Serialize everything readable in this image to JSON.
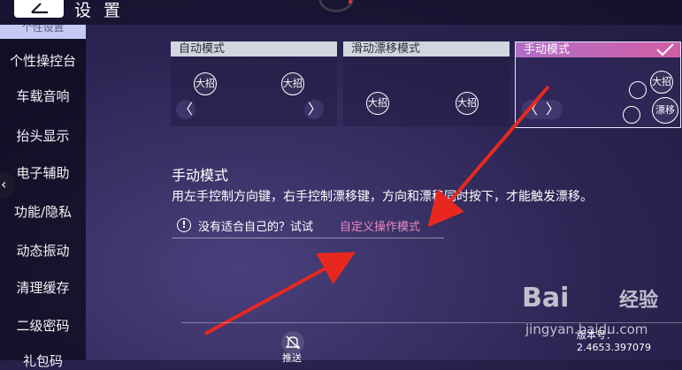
{
  "header": {
    "title": "设 置",
    "active_tab_partial": "个性设置"
  },
  "sidebar": {
    "items": [
      {
        "label": "个性操控台"
      },
      {
        "label": "车载音响"
      },
      {
        "label": "抬头显示"
      },
      {
        "label": "电子辅助"
      },
      {
        "label": "功能/隐私"
      },
      {
        "label": "动态振动"
      },
      {
        "label": "清理缓存"
      },
      {
        "label": "二级密码"
      },
      {
        "label": "礼包码"
      }
    ],
    "collapse_icon": "chevron-left-icon"
  },
  "modes": [
    {
      "title": "自动模式",
      "buttons": [
        "大招",
        "大招"
      ],
      "arrows": [
        "〈",
        "〉"
      ]
    },
    {
      "title": "滑动漂移模式",
      "buttons": [
        "大招",
        "大招"
      ]
    },
    {
      "title": "手动模式",
      "selected": true,
      "buttons": [
        "大招",
        "漂移"
      ],
      "arrows": [
        "〈",
        "〉"
      ],
      "icons": [
        "brake-icon",
        "handbrake-icon",
        "check-icon"
      ]
    }
  ],
  "description": {
    "title": "手动模式",
    "text": "用左手控制方向键，右手控制漂移键，方向和漂移同时按下，才能触发漂移。"
  },
  "hint": {
    "text": "没有适合自己的？试试",
    "link": "自定义操作模式",
    "icon": "info-icon"
  },
  "footer": {
    "mute_label": "推送",
    "version": "版本号：2.4653.397079"
  },
  "watermark": {
    "brand": "Bai",
    "brand2": "经验",
    "url": "jingyan.baidu.com"
  },
  "colors": {
    "accent_gradient_start": "#b06ec6",
    "accent_gradient_end": "#d25da5",
    "link": "#e98ac4",
    "annotation_arrow": "#e8281e"
  }
}
